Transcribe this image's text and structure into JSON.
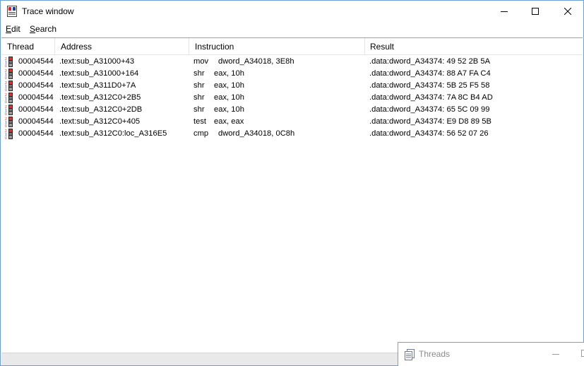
{
  "window": {
    "title": "Trace window",
    "icon": "trace-window-icon"
  },
  "menu": {
    "items": [
      {
        "label": "Edit",
        "underline": "E",
        "rest": "dit"
      },
      {
        "label": "Search",
        "underline": "S",
        "rest": "earch"
      }
    ]
  },
  "columns": [
    "Thread",
    "Address",
    "Instruction",
    "Result"
  ],
  "rows": [
    {
      "thread": "00004544",
      "address": ".text:sub_A31000+43",
      "mnemonic": "mov",
      "operands": "dword_A34018, 3E8h",
      "result": ".data:dword_A34374: 49 52 2B 5A"
    },
    {
      "thread": "00004544",
      "address": ".text:sub_A31000+164",
      "mnemonic": "shr",
      "operands": "eax, 10h",
      "result": ".data:dword_A34374: 88 A7 FA C4"
    },
    {
      "thread": "00004544",
      "address": ".text:sub_A311D0+7A",
      "mnemonic": "shr",
      "operands": "eax, 10h",
      "result": ".data:dword_A34374: 5B 25 F5 58"
    },
    {
      "thread": "00004544",
      "address": ".text:sub_A312C0+2B5",
      "mnemonic": "shr",
      "operands": "eax, 10h",
      "result": ".data:dword_A34374: 7A 8C B4 AD"
    },
    {
      "thread": "00004544",
      "address": ".text:sub_A312C0+2DB",
      "mnemonic": "shr",
      "operands": "eax, 10h",
      "result": ".data:dword_A34374: 65 5C 09 99"
    },
    {
      "thread": "00004544",
      "address": ".text:sub_A312C0+405",
      "mnemonic": "test",
      "operands": "eax, eax",
      "result": ".data:dword_A34374: E9 D8 89 5B"
    },
    {
      "thread": "00004544",
      "address": ".text:sub_A312C0:loc_A316E5",
      "mnemonic": "cmp",
      "operands": "dword_A34018, 0C8h",
      "result": ".data:dword_A34374: 56 52 07 26"
    }
  ],
  "threads_window": {
    "title": "Threads",
    "icon": "threads-icon"
  },
  "colors": {
    "border": "#6d9ed6",
    "icon_red": "#d8262b",
    "icon_blue": "#1c3f9e",
    "muted_text": "#8a8a8a"
  }
}
